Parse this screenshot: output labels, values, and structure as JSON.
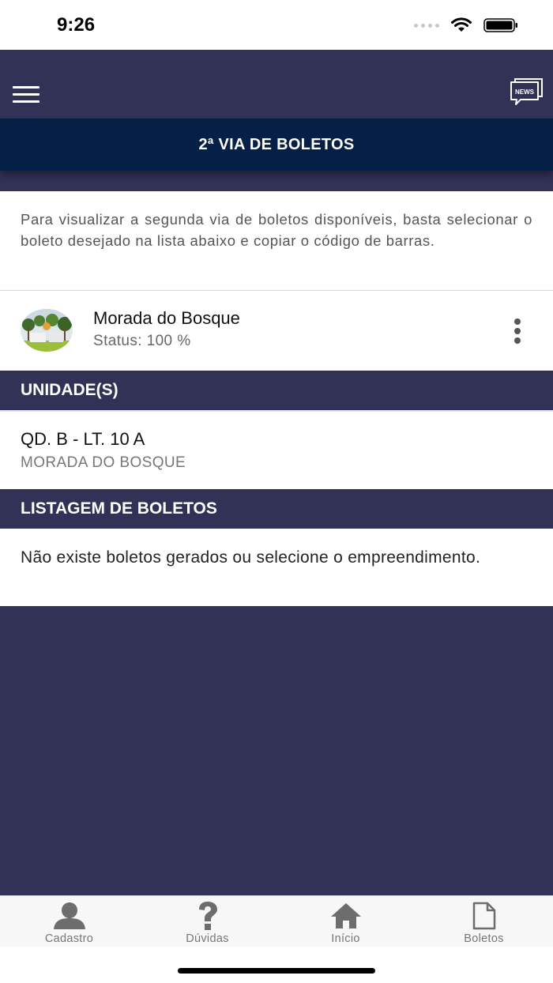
{
  "status_bar": {
    "time": "9:26"
  },
  "header": {
    "menu_icon": "hamburger-menu-icon",
    "news_icon": "news-chat-icon",
    "news_text": "NEWS"
  },
  "page_title": "2ª VIA DE BOLETOS",
  "intro_text": "Para visualizar a segunda via de boletos disponíveis, basta selecionar o boleto desejado na lista abaixo e copiar o código de barras.",
  "empreendimento": {
    "name": "Morada do Bosque",
    "status": "Status: 100 %"
  },
  "units_section": {
    "title": "UNIDADE(S)",
    "items": [
      {
        "title": "QD. B - LT. 10 A",
        "subtitle": "MORADA DO BOSQUE"
      }
    ]
  },
  "boletos_section": {
    "title": "LISTAGEM DE BOLETOS",
    "empty_message": "Não existe boletos gerados ou selecione o empreendimento."
  },
  "tabs": [
    {
      "label": "Cadastro",
      "icon": "user-icon"
    },
    {
      "label": "Dúvidas",
      "icon": "question-icon"
    },
    {
      "label": "Início",
      "icon": "home-icon"
    },
    {
      "label": "Boletos",
      "icon": "document-icon"
    }
  ],
  "colors": {
    "header": "#323156",
    "title_bar": "#061f46",
    "tab_icon": "#6d6d6d"
  }
}
